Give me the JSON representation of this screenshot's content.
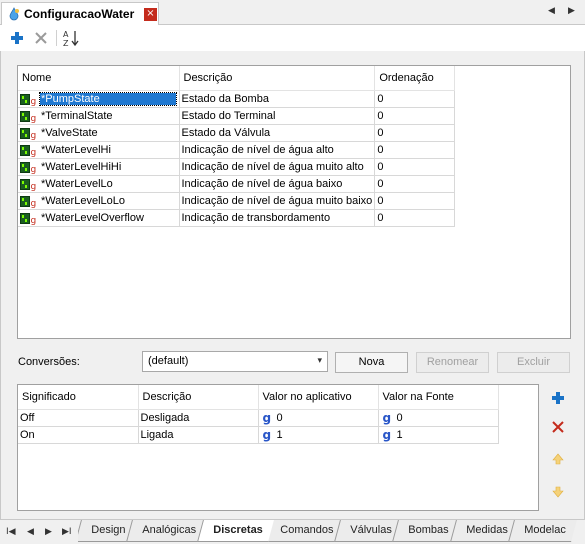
{
  "window": {
    "tab_title": "ConfiguracaoWater",
    "close_glyph": "×",
    "nav_prev": "◀",
    "nav_next": "▶"
  },
  "toolbar": {
    "add_icon": "plus-icon",
    "delete_icon": "x-icon",
    "sort_icon": "sort-az-icon"
  },
  "tags_grid": {
    "headers": {
      "name": "Nome",
      "description": "Descrição",
      "order": "Ordenação"
    },
    "rows": [
      {
        "name": "*PumpState",
        "description": "Estado da Bomba",
        "order": "0",
        "selected": true
      },
      {
        "name": "*TerminalState",
        "description": "Estado do Terminal",
        "order": "0"
      },
      {
        "name": "*ValveState",
        "description": "Estado da Válvula",
        "order": "0"
      },
      {
        "name": "*WaterLevelHi",
        "description": "Indicação de nível de água alto",
        "order": "0"
      },
      {
        "name": "*WaterLevelHiHi",
        "description": "Indicação de nível de água muito alto",
        "order": "0"
      },
      {
        "name": "*WaterLevelLo",
        "description": "Indicação de nível de água baixo",
        "order": "0"
      },
      {
        "name": "*WaterLevelLoLo",
        "description": "Indicação de nível de água muito baixo",
        "order": "0"
      },
      {
        "name": "*WaterLevelOverflow",
        "description": "Indicação de transbordamento",
        "order": "0"
      }
    ]
  },
  "conversions": {
    "label": "Conversões:",
    "selected": "(default)",
    "new_button": "Nova",
    "rename_button": "Renomear",
    "delete_button": "Excluir"
  },
  "values_grid": {
    "headers": {
      "meaning": "Significado",
      "description": "Descrição",
      "app_value": "Valor no aplicativo",
      "source_value": "Valor na Fonte"
    },
    "value_glyph": "g",
    "rows": [
      {
        "meaning": "Off",
        "description": "Desligada",
        "app_value": "0",
        "source_value": "0"
      },
      {
        "meaning": "On",
        "description": "Ligada",
        "app_value": "1",
        "source_value": "1"
      }
    ]
  },
  "sheet_tabs": {
    "nav": [
      "I◀",
      "◀",
      "▶",
      "▶I"
    ],
    "tabs": [
      "Design",
      "Analógicas",
      "Discretas",
      "Comandos",
      "Válvulas",
      "Bombas",
      "Medidas",
      "Modelac"
    ],
    "active": "Discretas"
  },
  "colors": {
    "selection": "#1f78d1",
    "add": "#1a73c7",
    "delete_red": "#c42b1c",
    "value_icon": "#2956c8"
  }
}
